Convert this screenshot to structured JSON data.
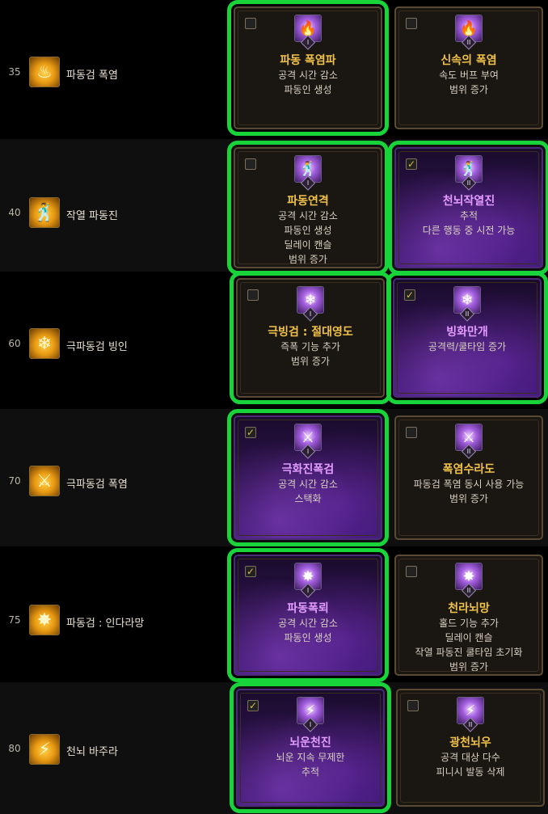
{
  "rows": [
    {
      "level": "35",
      "skill": "파동검 폭염",
      "icon": "flame-burst-icon",
      "options": [
        {
          "tier": "I",
          "title": "파동 폭염파",
          "lines": [
            "공격 시간 감소",
            "파동인 생성"
          ],
          "checked": false
        },
        {
          "tier": "II",
          "title": "신속의 폭염",
          "lines": [
            "속도 버프 부여",
            "범위 증가"
          ],
          "checked": false
        }
      ]
    },
    {
      "level": "40",
      "skill": "작열 파동진",
      "icon": "dancer-icon",
      "options": [
        {
          "tier": "I",
          "title": "파동연격",
          "lines": [
            "공격 시간 감소",
            "파동인 생성",
            "딜레이 캔슬",
            "범위 증가"
          ],
          "checked": false
        },
        {
          "tier": "II",
          "title": "천뇌작열진",
          "lines": [
            "추적",
            "다른 행동 중 시전 가능"
          ],
          "checked": true
        }
      ]
    },
    {
      "level": "60",
      "skill": "극파동검 빙인",
      "icon": "ice-crystal-icon",
      "options": [
        {
          "tier": "I",
          "title": "극빙검 : 절대영도",
          "lines": [
            "즉폭 기능 추가",
            "범위 증가"
          ],
          "checked": false
        },
        {
          "tier": "II",
          "title": "빙화만개",
          "lines": [
            "공격력/쿨타임 증가"
          ],
          "checked": true
        }
      ]
    },
    {
      "level": "70",
      "skill": "극파동검 폭염",
      "icon": "slash-flame-icon",
      "options": [
        {
          "tier": "I",
          "title": "극화진폭검",
          "lines": [
            "공격 시간 감소",
            "스택화"
          ],
          "checked": true
        },
        {
          "tier": "II",
          "title": "폭염수라도",
          "lines": [
            "파동검 폭염 동시 사용 가능",
            "범위 증가"
          ],
          "checked": false
        }
      ]
    },
    {
      "level": "75",
      "skill": "파동검 : 인다라망",
      "icon": "lightning-sphere-icon",
      "options": [
        {
          "tier": "I",
          "title": "파동폭뢰",
          "lines": [
            "공격 시간 감소",
            "파동인 생성"
          ],
          "checked": true
        },
        {
          "tier": "II",
          "title": "천라뇌망",
          "lines": [
            "홀드 기능 추가",
            "딜레이 캔슬",
            "작열 파동진 쿨타임 초기화",
            "범위 증가"
          ],
          "checked": false
        }
      ]
    },
    {
      "level": "80",
      "skill": "천뇌 바주라",
      "icon": "thunder-cloud-icon",
      "options": [
        {
          "tier": "I",
          "title": "뇌운천진",
          "lines": [
            "뇌운 지속 무제한",
            "추적"
          ],
          "checked": true
        },
        {
          "tier": "II",
          "title": "광천뇌우",
          "lines": [
            "공격 대상 다수",
            "피니시 발동 삭제"
          ],
          "checked": false
        }
      ]
    }
  ]
}
